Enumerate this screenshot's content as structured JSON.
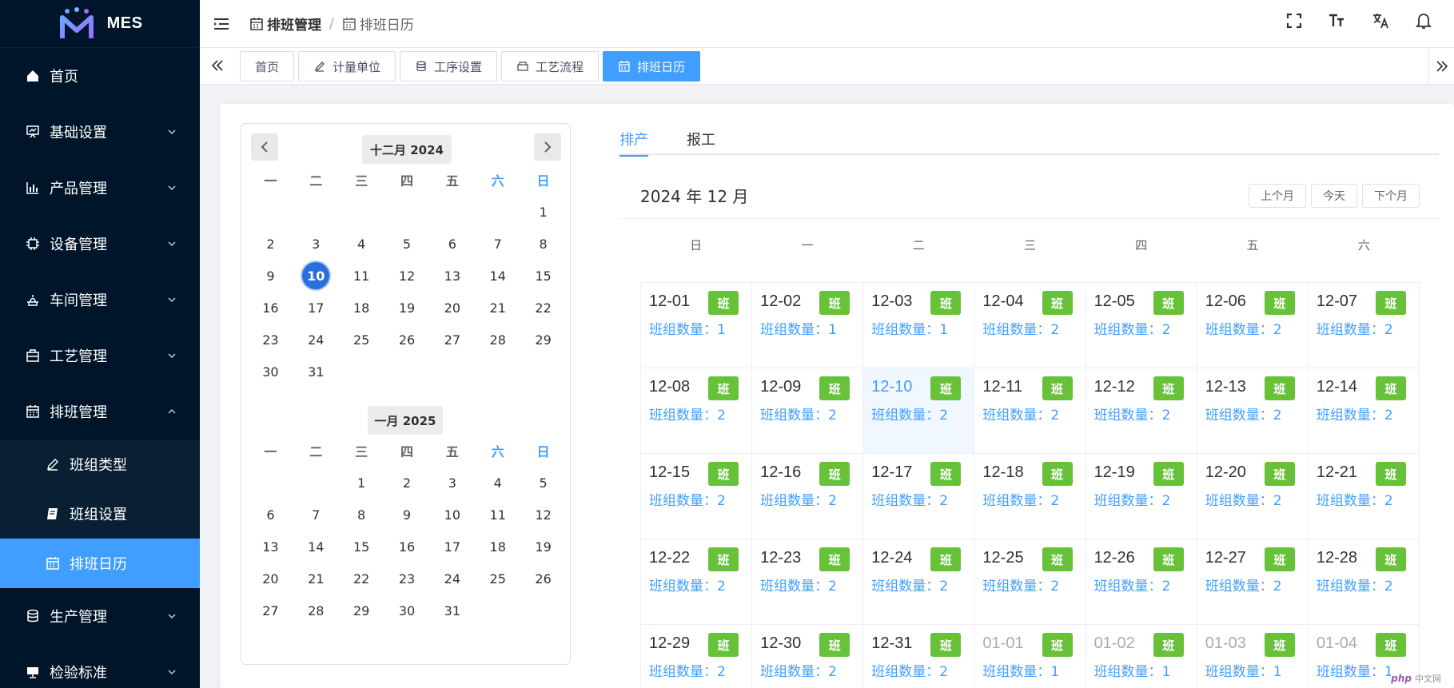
{
  "app": {
    "title": "MES"
  },
  "sidebar": {
    "items": [
      {
        "label": "首页",
        "icon": "home-icon"
      },
      {
        "label": "基础设置",
        "icon": "board-icon"
      },
      {
        "label": "产品管理",
        "icon": "chart-icon"
      },
      {
        "label": "设备管理",
        "icon": "chip-icon"
      },
      {
        "label": "车间管理",
        "icon": "workshop-icon"
      },
      {
        "label": "工艺管理",
        "icon": "bag-icon"
      },
      {
        "label": "排班管理",
        "icon": "calendar-icon"
      }
    ],
    "sub_items": [
      {
        "label": "班组类型",
        "icon": "pen-icon"
      },
      {
        "label": "班组设置",
        "icon": "book-icon"
      },
      {
        "label": "排班日历",
        "icon": "calendar-icon"
      }
    ],
    "bottom_items": [
      {
        "label": "生产管理",
        "icon": "database-icon"
      },
      {
        "label": "检验标准",
        "icon": "monitor-icon"
      }
    ]
  },
  "breadcrumb": {
    "first": "排班管理",
    "separator": "/",
    "last": "排班日历"
  },
  "tags": [
    {
      "label": "首页"
    },
    {
      "label": "计量单位"
    },
    {
      "label": "工序设置"
    },
    {
      "label": "工艺流程"
    },
    {
      "label": "排班日历"
    }
  ],
  "mini_calendar": {
    "month1": {
      "title": "十二月 2024"
    },
    "month2": {
      "title": "一月 2025"
    },
    "weekdays": [
      "一",
      "二",
      "三",
      "四",
      "五",
      "六",
      "日"
    ],
    "selected_day": "10"
  },
  "tabs": [
    {
      "label": "排产"
    },
    {
      "label": "报工"
    }
  ],
  "calendar": {
    "title": "2024 年 12 月",
    "buttons": {
      "prev": "上个月",
      "today": "今天",
      "next": "下个月"
    },
    "weekdays": [
      "日",
      "一",
      "二",
      "三",
      "四",
      "五",
      "六"
    ],
    "badge": "班",
    "count_label": "班组数量：",
    "cells": [
      {
        "date": "12-01",
        "count": "1"
      },
      {
        "date": "12-02",
        "count": "1"
      },
      {
        "date": "12-03",
        "count": "1"
      },
      {
        "date": "12-04",
        "count": "2"
      },
      {
        "date": "12-05",
        "count": "2"
      },
      {
        "date": "12-06",
        "count": "2"
      },
      {
        "date": "12-07",
        "count": "2"
      },
      {
        "date": "12-08",
        "count": "2"
      },
      {
        "date": "12-09",
        "count": "2"
      },
      {
        "date": "12-10",
        "count": "2"
      },
      {
        "date": "12-11",
        "count": "2"
      },
      {
        "date": "12-12",
        "count": "2"
      },
      {
        "date": "12-13",
        "count": "2"
      },
      {
        "date": "12-14",
        "count": "2"
      },
      {
        "date": "12-15",
        "count": "2"
      },
      {
        "date": "12-16",
        "count": "2"
      },
      {
        "date": "12-17",
        "count": "2"
      },
      {
        "date": "12-18",
        "count": "2"
      },
      {
        "date": "12-19",
        "count": "2"
      },
      {
        "date": "12-20",
        "count": "2"
      },
      {
        "date": "12-21",
        "count": "2"
      },
      {
        "date": "12-22",
        "count": "2"
      },
      {
        "date": "12-23",
        "count": "2"
      },
      {
        "date": "12-24",
        "count": "2"
      },
      {
        "date": "12-25",
        "count": "2"
      },
      {
        "date": "12-26",
        "count": "2"
      },
      {
        "date": "12-27",
        "count": "2"
      },
      {
        "date": "12-28",
        "count": "2"
      },
      {
        "date": "12-29",
        "count": "2"
      },
      {
        "date": "12-30",
        "count": "2"
      },
      {
        "date": "12-31",
        "count": "2"
      },
      {
        "date": "01-01",
        "count": "1"
      },
      {
        "date": "01-02",
        "count": "1"
      },
      {
        "date": "01-03",
        "count": "1"
      },
      {
        "date": "01-04",
        "count": "1"
      }
    ]
  },
  "watermark": {
    "logo": "php",
    "text": "中文网"
  },
  "colors": {
    "sidebar": "#001529",
    "accent": "#409eff",
    "badge": "#67c23a"
  }
}
